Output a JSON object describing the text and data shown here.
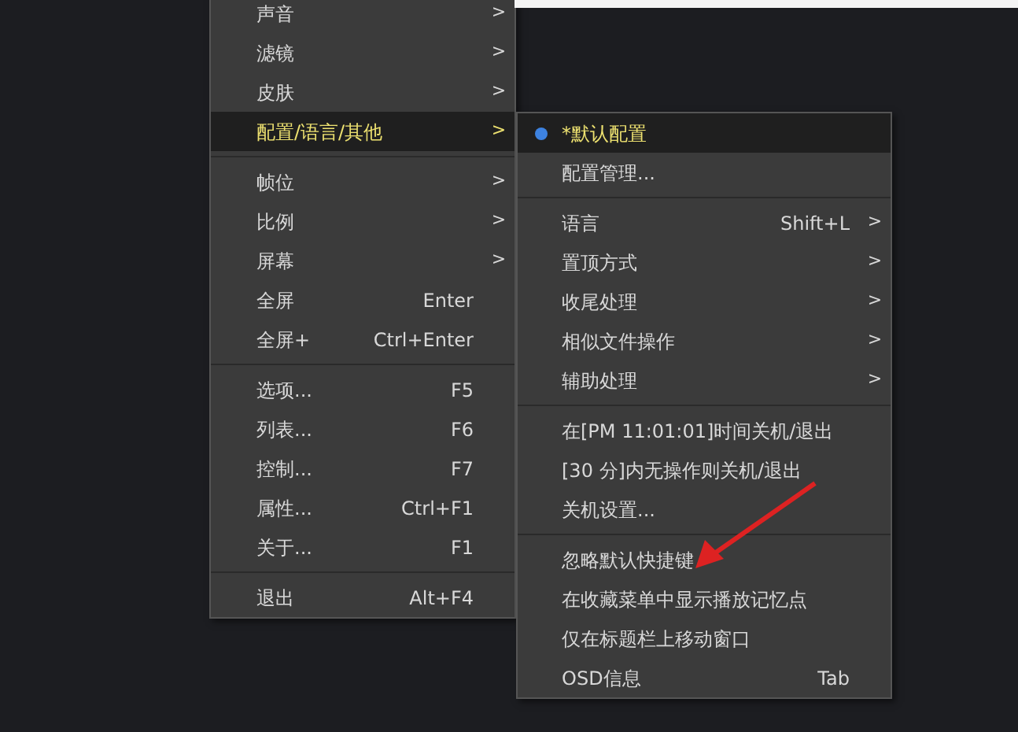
{
  "main_menu": [
    {
      "kind": "item",
      "label": "声音",
      "arrow": ">",
      "highlighted": false
    },
    {
      "kind": "item",
      "label": "滤镜",
      "arrow": ">",
      "highlighted": false
    },
    {
      "kind": "item",
      "label": "皮肤",
      "arrow": ">",
      "highlighted": false
    },
    {
      "kind": "item",
      "label": "配置/语言/其他",
      "arrow": ">",
      "highlighted": true
    },
    {
      "kind": "separator"
    },
    {
      "kind": "item",
      "label": "帧位",
      "arrow": ">",
      "highlighted": false
    },
    {
      "kind": "item",
      "label": "比例",
      "arrow": ">",
      "highlighted": false
    },
    {
      "kind": "item",
      "label": "屏幕",
      "arrow": ">",
      "highlighted": false
    },
    {
      "kind": "item",
      "label": "全屏",
      "shortcut": "Enter",
      "highlighted": false
    },
    {
      "kind": "item",
      "label": "全屏+",
      "shortcut": "Ctrl+Enter",
      "highlighted": false
    },
    {
      "kind": "separator"
    },
    {
      "kind": "item",
      "label": "选项...",
      "shortcut": "F5",
      "highlighted": false
    },
    {
      "kind": "item",
      "label": "列表...",
      "shortcut": "F6",
      "highlighted": false
    },
    {
      "kind": "item",
      "label": "控制...",
      "shortcut": "F7",
      "highlighted": false
    },
    {
      "kind": "item",
      "label": "属性...",
      "shortcut": "Ctrl+F1",
      "highlighted": false
    },
    {
      "kind": "item",
      "label": "关于...",
      "shortcut": "F1",
      "highlighted": false
    },
    {
      "kind": "separator"
    },
    {
      "kind": "item",
      "label": "退出",
      "shortcut": "Alt+F4",
      "highlighted": false
    }
  ],
  "submenu": [
    {
      "kind": "radio",
      "label": "*默认配置",
      "checked": true,
      "highlighted": true
    },
    {
      "kind": "item",
      "label": "配置管理...",
      "highlighted": false
    },
    {
      "kind": "separator"
    },
    {
      "kind": "item",
      "label": "语言",
      "shortcut": "Shift+L",
      "arrow": ">",
      "highlighted": false
    },
    {
      "kind": "item",
      "label": "置顶方式",
      "arrow": ">",
      "highlighted": false
    },
    {
      "kind": "item",
      "label": "收尾处理",
      "arrow": ">",
      "highlighted": false
    },
    {
      "kind": "item",
      "label": "相似文件操作",
      "arrow": ">",
      "highlighted": false
    },
    {
      "kind": "item",
      "label": "辅助处理",
      "arrow": ">",
      "highlighted": false
    },
    {
      "kind": "separator"
    },
    {
      "kind": "item",
      "label": "在[PM 11:01:01]时间关机/退出",
      "highlighted": false
    },
    {
      "kind": "item",
      "label": "[30 分]内无操作则关机/退出",
      "highlighted": false
    },
    {
      "kind": "item",
      "label": "关机设置...",
      "highlighted": false
    },
    {
      "kind": "separator"
    },
    {
      "kind": "item",
      "label": "忽略默认快捷键",
      "highlighted": false
    },
    {
      "kind": "item",
      "label": "在收藏菜单中显示播放记忆点",
      "highlighted": false
    },
    {
      "kind": "item",
      "label": "仅在标题栏上移动窗口",
      "highlighted": false
    },
    {
      "kind": "item",
      "label": "OSD信息",
      "shortcut": "Tab",
      "highlighted": false
    }
  ]
}
